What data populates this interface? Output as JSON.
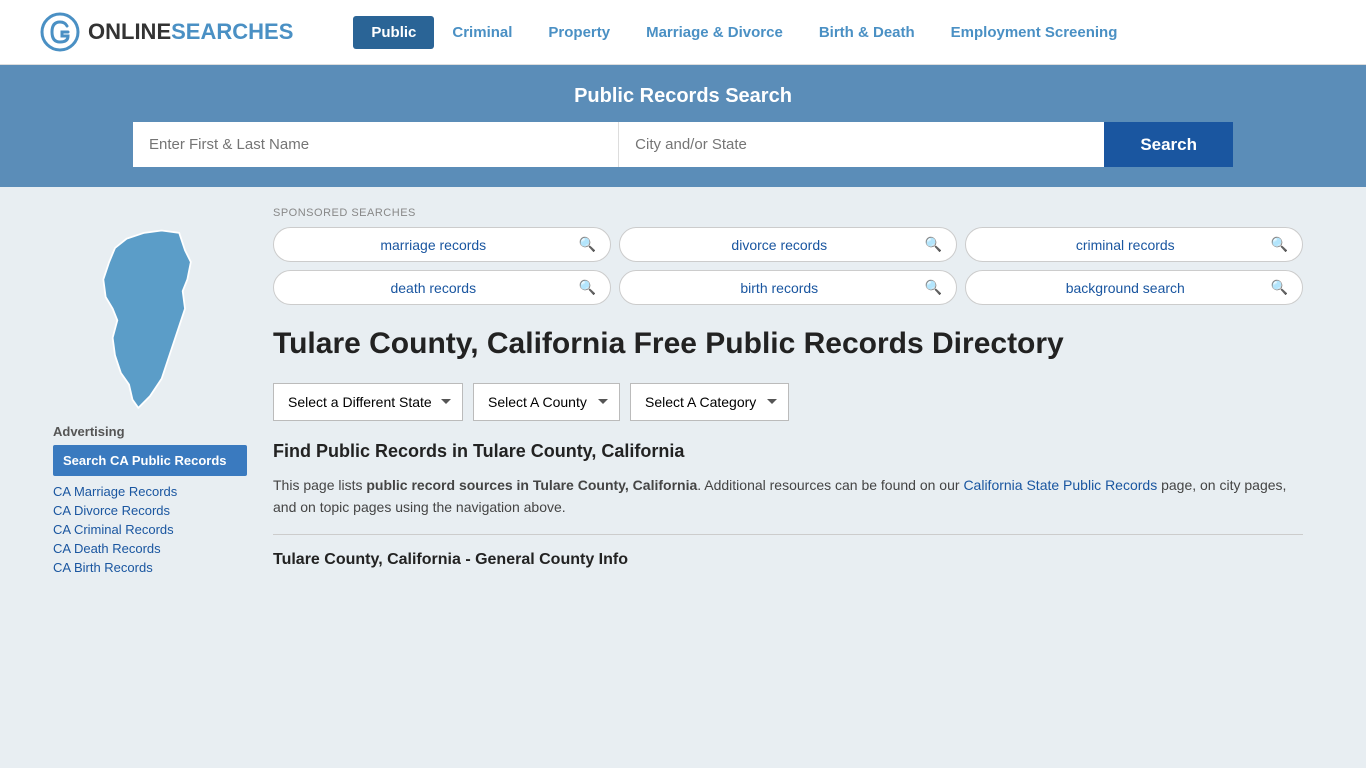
{
  "header": {
    "logo_online": "ONLINE",
    "logo_searches": "SEARCHES",
    "nav_items": [
      {
        "label": "Public",
        "active": true
      },
      {
        "label": "Criminal",
        "active": false
      },
      {
        "label": "Property",
        "active": false
      },
      {
        "label": "Marriage & Divorce",
        "active": false
      },
      {
        "label": "Birth & Death",
        "active": false
      },
      {
        "label": "Employment Screening",
        "active": false
      }
    ]
  },
  "search_banner": {
    "title": "Public Records Search",
    "name_placeholder": "Enter First & Last Name",
    "location_placeholder": "City and/or State",
    "search_button": "Search"
  },
  "sponsored": {
    "label": "SPONSORED SEARCHES",
    "items": [
      {
        "text": "marriage records"
      },
      {
        "text": "divorce records"
      },
      {
        "text": "criminal records"
      },
      {
        "text": "death records"
      },
      {
        "text": "birth records"
      },
      {
        "text": "background search"
      }
    ]
  },
  "sidebar": {
    "ad_label": "Advertising",
    "featured_text": "Search CA Public Records",
    "links": [
      {
        "text": "CA Marriage Records"
      },
      {
        "text": "CA Divorce Records"
      },
      {
        "text": "CA Criminal Records"
      },
      {
        "text": "CA Death Records"
      },
      {
        "text": "CA Birth Records"
      }
    ]
  },
  "county": {
    "heading": "Tulare County, California Free Public Records Directory",
    "dropdowns": {
      "state": "Select a Different State",
      "county": "Select A County",
      "category": "Select A Category"
    },
    "find_heading": "Find Public Records in Tulare County, California",
    "find_text_part1": "This page lists ",
    "find_text_bold": "public record sources in Tulare County, California",
    "find_text_part2": ". Additional resources can be found on our ",
    "find_link_text": "California State Public Records",
    "find_text_part3": " page, on city pages, and on topic pages using the navigation above.",
    "general_info_heading": "Tulare County, California - General County Info"
  },
  "colors": {
    "nav_active_bg": "#2a6496",
    "search_banner_bg": "#5b8db8",
    "search_btn_bg": "#1a56a0",
    "link_color": "#1a56a0",
    "sidebar_featured_bg": "#3a7abf"
  }
}
